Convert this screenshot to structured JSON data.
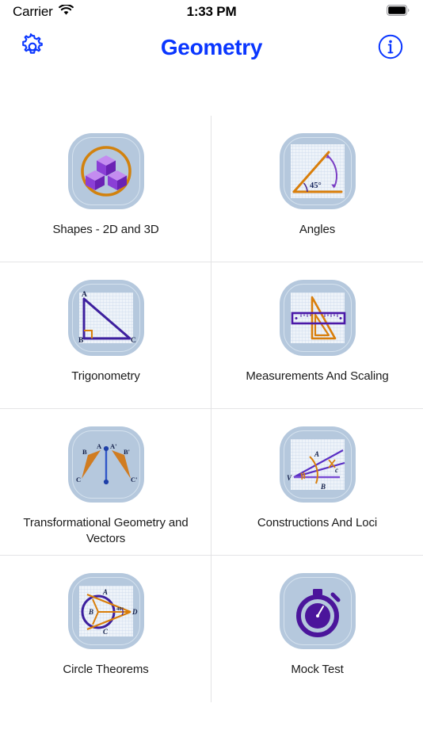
{
  "status_bar": {
    "carrier": "Carrier",
    "wifi_icon": "wifi-icon",
    "time": "1:33 PM",
    "battery_icon": "battery-full-icon"
  },
  "nav": {
    "title": "Geometry",
    "settings_icon": "gear-icon",
    "info_icon": "info-circle-icon",
    "accent_color": "#0a36ff"
  },
  "theme": {
    "tile_background": "#b5c8dd",
    "tile_inner_border": "#d5e2ee",
    "purple": "#4b148f",
    "orange": "#d97e0a",
    "divider": "#e2e2e4",
    "label_color": "#1b1b1b"
  },
  "grid": {
    "items": [
      {
        "id": "shapes-2d-and-3d",
        "label": "Shapes - 2D and 3D",
        "icon": "cubes-3d-icon",
        "figure_labels": []
      },
      {
        "id": "angles",
        "label": "Angles",
        "icon": "angle-45-degrees-icon",
        "figure_labels": [
          "45°"
        ]
      },
      {
        "id": "trigonometry",
        "label": "Trigonometry",
        "icon": "right-triangle-icon",
        "figure_labels": [
          "A",
          "B",
          "C"
        ]
      },
      {
        "id": "measurements-and-scaling",
        "label": "Measurements And Scaling",
        "icon": "ruler-and-set-square-icon",
        "figure_labels": []
      },
      {
        "id": "transformational-geometry-and-vectors",
        "label": "Transformational Geometry and Vectors",
        "icon": "reflection-triangles-icon",
        "figure_labels": [
          "A",
          "B",
          "C",
          "A'",
          "B'",
          "C'"
        ]
      },
      {
        "id": "constructions-and-loci",
        "label": "Constructions And Loci",
        "icon": "angle-bisector-construction-icon",
        "figure_labels": [
          "V",
          "A",
          "B",
          "c"
        ]
      },
      {
        "id": "circle-theorems",
        "label": "Circle Theorems",
        "icon": "circle-tangents-icon",
        "figure_labels": [
          "A",
          "B",
          "C",
          "D",
          "40°"
        ]
      },
      {
        "id": "mock-test",
        "label": "Mock Test",
        "icon": "stopwatch-icon",
        "figure_labels": []
      }
    ]
  }
}
